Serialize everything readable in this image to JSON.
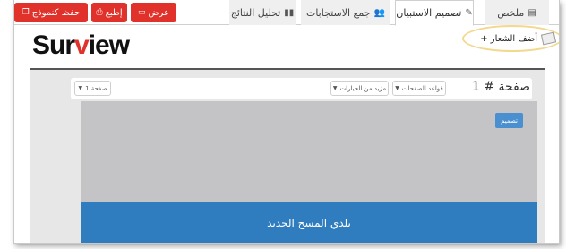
{
  "toolbar": {
    "save_template_label": "حفظ كنموذج",
    "print_label": "إطبع",
    "preview_label": "عرض",
    "colors": {
      "action": "#e0312a"
    }
  },
  "tabs": [
    {
      "label": "ملخص",
      "icon": "summary-icon",
      "active": false
    },
    {
      "label": "تصميم الاستبيان",
      "icon": "edit-icon",
      "active": true
    },
    {
      "label": "جمع الاستجابات",
      "icon": "users-icon",
      "active": false
    },
    {
      "label": "تحليل النتائج",
      "icon": "bar-chart-icon",
      "active": false
    }
  ],
  "header": {
    "logo_text_1": "Sur",
    "logo_text_2": "v",
    "logo_text_3": "iew",
    "add_logo_label": "+ أضف الشعار"
  },
  "page": {
    "title": "صفحة # 1",
    "page_rules_label": "قواعد الصفحات",
    "more_options_label": "مزيد من الخيارات",
    "page_select_label": "صفحة 1"
  },
  "canvas": {
    "design_button_label": "تصميم",
    "survey_title": "بلدي المسح الجديد",
    "colors": {
      "banner": "#2f7dbf",
      "design_button": "#4a8fd0"
    }
  }
}
